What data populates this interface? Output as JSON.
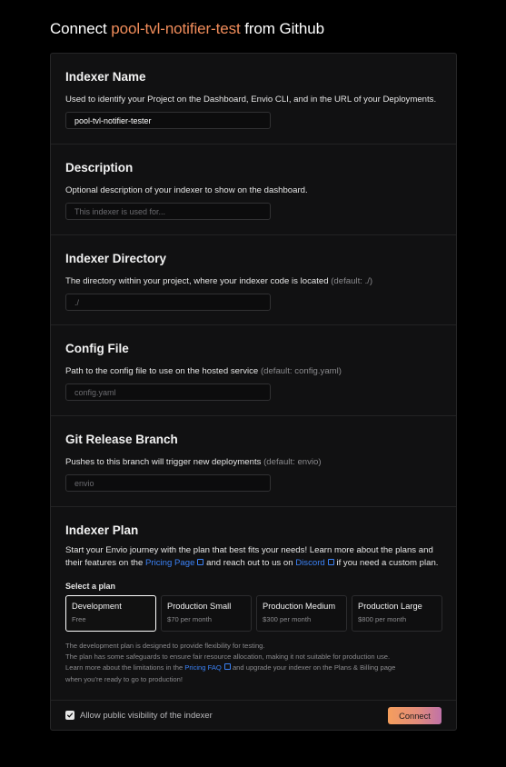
{
  "header": {
    "prefix": "Connect",
    "repo": "pool-tvl-notifier-test",
    "suffix": "from Github"
  },
  "sections": {
    "name": {
      "title": "Indexer Name",
      "description": "Used to identify your Project on the Dashboard, Envio CLI, and in the URL of your Deployments.",
      "value": "pool-tvl-notifier-tester",
      "placeholder": ""
    },
    "description": {
      "title": "Description",
      "description": "Optional description of your indexer to show on the dashboard.",
      "value": "",
      "placeholder": "This indexer is used for..."
    },
    "directory": {
      "title": "Indexer Directory",
      "description": "The directory within your project, where your indexer code is located",
      "hint": "(default: ./)",
      "value": "",
      "placeholder": "./"
    },
    "config": {
      "title": "Config File",
      "description": "Path to the config file to use on the hosted service",
      "hint": "(default: config.yaml)",
      "value": "",
      "placeholder": "config.yaml"
    },
    "branch": {
      "title": "Git Release Branch",
      "description": "Pushes to this branch will trigger new deployments",
      "hint": "(default: envio)",
      "value": "",
      "placeholder": "envio"
    }
  },
  "plan": {
    "title": "Indexer Plan",
    "intro_1": "Start your Envio journey with the plan that best fits your needs! Learn more about the plans and their features on the",
    "pricing_link": "Pricing Page",
    "intro_2": "and reach out to us on",
    "discord_link": "Discord",
    "intro_3": "if you need a custom plan.",
    "select_label": "Select a plan",
    "selected": "Development",
    "options": [
      {
        "name": "Development",
        "price": "Free"
      },
      {
        "name": "Production Small",
        "price": "$70 per month"
      },
      {
        "name": "Production Medium",
        "price": "$300 per month"
      },
      {
        "name": "Production Large",
        "price": "$800 per month"
      }
    ],
    "note_1": "The development plan is designed to provide flexibility for testing.",
    "note_2": "The plan has some safeguards to ensure fair resource allocation, making it not suitable for production use.",
    "note_3a": "Learn more about the limitations in the",
    "faq_link": "Pricing FAQ",
    "note_3b": "and upgrade your indexer on the Plans & Billing page",
    "note_4": "when you're ready to go to production!"
  },
  "footer": {
    "visibility_label": "Allow public visibility of the indexer",
    "visibility_checked": true,
    "connect_label": "Connect"
  },
  "colors": {
    "accent_orange": "#f08c5a",
    "link_blue": "#3b82f6",
    "background": "#000000",
    "card": "#111112"
  }
}
